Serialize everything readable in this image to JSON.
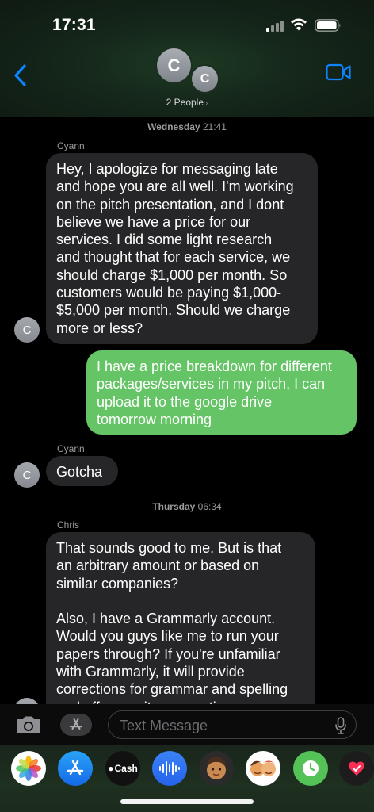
{
  "status_bar": {
    "time": "17:31"
  },
  "header": {
    "avatar_main": "C",
    "avatar_secondary": "C",
    "people_label": "2 People",
    "people_chevron": "›"
  },
  "thread": {
    "stamp1": {
      "day": "Wednesday",
      "time": "21:41"
    },
    "msg1": {
      "sender": "Cyann",
      "avatar": "C",
      "text": "Hey, I apologize for messaging late\nand hope you are all well. I'm working\non the pitch presentation, and I dont\nbelieve we have a price for our\nservices. I did some light research\nand thought that for each service, we\nshould charge $1,000 per month. So\ncustomers would be paying $1,000-\n$5,000 per month. Should we charge\nmore or less?"
    },
    "msg2": {
      "text": "I have a price breakdown for different\npackages/services in my pitch, I can\nupload it to the google drive\ntomorrow morning"
    },
    "msg3": {
      "sender": "Cyann",
      "avatar": "C",
      "text": "Gotcha"
    },
    "stamp2": {
      "day": "Thursday",
      "time": "06:34"
    },
    "msg4": {
      "sender": "Chris",
      "text": "That sounds good to me. But is that\nan arbitrary amount or based on\nsimilar companies?\n\nAlso, I have a Grammarly account.\nWould you guys like me to run your\npapers through? If you're unfamiliar\nwith Grammarly, it will provide\ncorrections for grammar and spelling\nand offer rewrite suggestions"
    }
  },
  "input_bar": {
    "placeholder": "Text Message"
  },
  "app_drawer": {
    "apps": [
      {
        "name": "photos-app-icon"
      },
      {
        "name": "app-store-icon"
      },
      {
        "name": "apple-cash-icon",
        "label": "Cash"
      },
      {
        "name": "audio-message-icon"
      },
      {
        "name": "memoji-icon"
      },
      {
        "name": "memoji-stickers-icon"
      },
      {
        "name": "activity-icon"
      },
      {
        "name": "digital-touch-icon"
      }
    ]
  },
  "colors": {
    "accent_blue": "#0a84ff",
    "outgoing_green": "#65c466",
    "incoming_gray": "#262628"
  }
}
